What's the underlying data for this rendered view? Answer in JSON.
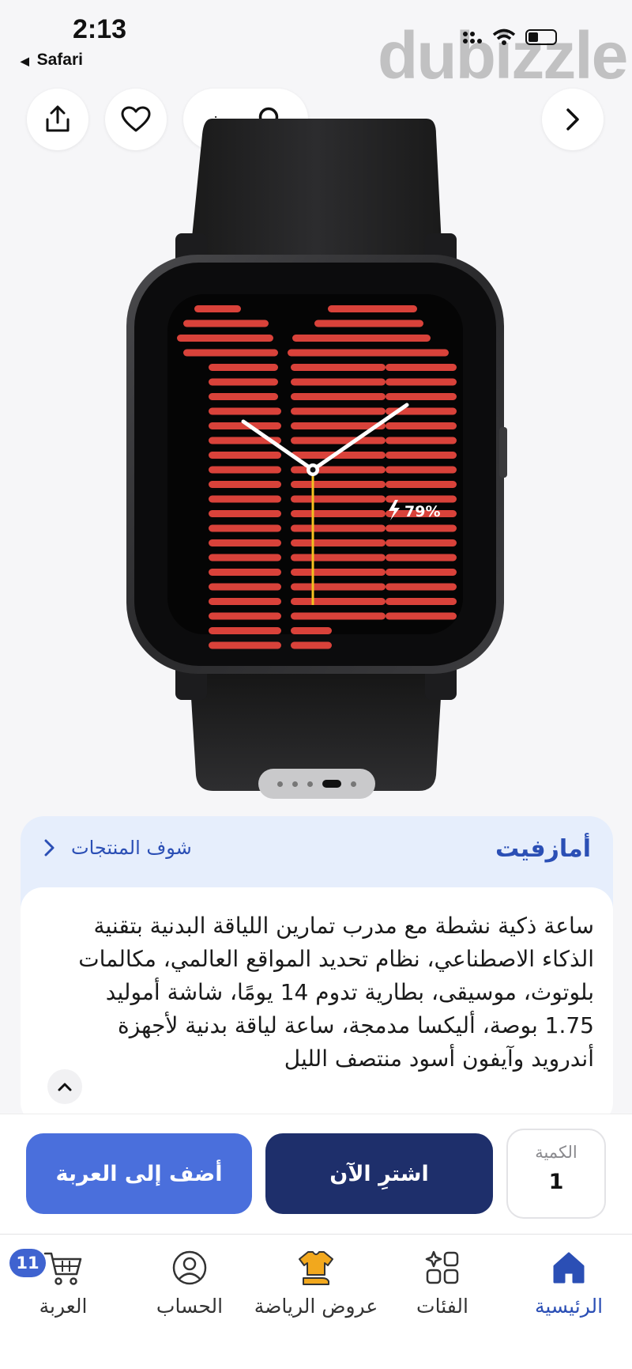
{
  "status_bar": {
    "time": "2:13",
    "back_app": "Safari",
    "watermark": "dubizzle"
  },
  "top_bar": {
    "search_label": "بحث"
  },
  "product": {
    "battery_readout": "79%"
  },
  "brand": {
    "name": "أمازفيت",
    "see_products": "شوف المنتجات"
  },
  "description": "ساعة ذكية نشطة مع مدرب تمارين اللياقة البدنية بتقنية الذكاء الاصطناعي، نظام تحديد المواقع العالمي، مكالمات بلوتوث، موسيقى، بطارية تدوم 14 يومًا، شاشة أموليد 1.75 بوصة، أليكسا مدمجة، ساعة لياقة بدنية لأجهزة أندرويد وآيفون أسود منتصف الليل",
  "actions": {
    "add_to_cart": "أضف إلى العربة",
    "buy_now": "اشترِ الآن",
    "quantity_label": "الكمية",
    "quantity_value": "1"
  },
  "bottom_nav": {
    "home": "الرئيسية",
    "categories": "الفئات",
    "sports_offers": "عروض الرياضة",
    "account": "الحساب",
    "cart": "العربة",
    "cart_count": "11"
  },
  "colors": {
    "primary": "#4a6fdc",
    "dark_primary": "#1e2f6b",
    "brand_text": "#2b4fb5",
    "watch_face_red": "#d9423a"
  }
}
